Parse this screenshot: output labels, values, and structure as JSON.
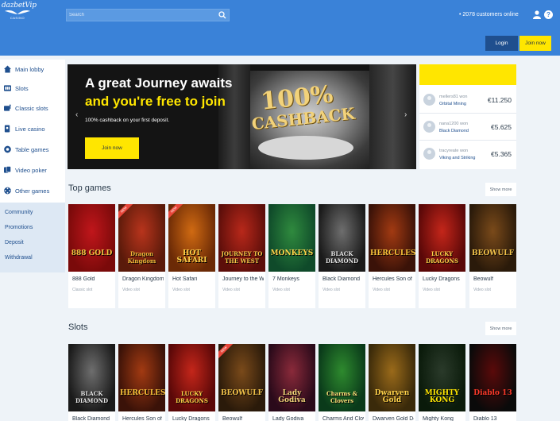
{
  "header": {
    "logo_text": "dazbetVip",
    "logo_sub": "CASINO",
    "search_placeholder": "Search",
    "online_text": "• 2078 customers online",
    "login_label": "Login",
    "join_label": "Join now"
  },
  "sidebar": {
    "items": [
      {
        "label": "Main lobby",
        "icon": "home-icon"
      },
      {
        "label": "Slots",
        "icon": "slots-icon"
      },
      {
        "label": "Classic slots",
        "icon": "classic-slots-icon"
      },
      {
        "label": "Live casino",
        "icon": "live-casino-icon"
      },
      {
        "label": "Table games",
        "icon": "table-games-icon"
      },
      {
        "label": "Video poker",
        "icon": "video-poker-icon"
      },
      {
        "label": "Other games",
        "icon": "other-games-icon"
      }
    ],
    "links": [
      "Community",
      "Promotions",
      "Deposit",
      "Withdrawal"
    ]
  },
  "banner": {
    "headline_1": "A great Journey awaits",
    "headline_2": "and you're free to join",
    "subtitle": "100% cashback on your first deposit.",
    "button": "Join now",
    "graphic_top": "100%",
    "graphic_bottom": "CASHBACK",
    "prev": "‹",
    "next": "›"
  },
  "winners": [
    {
      "name": "mellers81 won",
      "game": "Orbital Mining",
      "amount": "€11.250"
    },
    {
      "name": "nana1200 won",
      "game": "Black Diamond",
      "amount": "€5.625"
    },
    {
      "name": "tracyreate won",
      "game": "Viking and Striking",
      "amount": "€5.365"
    }
  ],
  "top_games": {
    "title": "Top games",
    "show_more": "Show more",
    "games": [
      {
        "name": "888 Gold",
        "type": "Classic slot",
        "art": "888 GOLD",
        "new": ""
      },
      {
        "name": "Dragon Kingdom",
        "type": "Video slot",
        "art": "Dragon Kingdom",
        "new": "NEW"
      },
      {
        "name": "Hot Safari",
        "type": "Video slot",
        "art": "HOT SAFARI",
        "new": "NEW"
      },
      {
        "name": "Journey to the West",
        "type": "Video slot",
        "art": "JOURNEY TO THE WEST",
        "new": ""
      },
      {
        "name": "7 Monkeys",
        "type": "Video slot",
        "art": "MONKEYS",
        "new": ""
      },
      {
        "name": "Black Diamond",
        "type": "Video slot",
        "art": "BLACK DIAMOND",
        "new": ""
      },
      {
        "name": "Hercules Son of Zeus",
        "type": "Video slot",
        "art": "HERCULES",
        "new": ""
      },
      {
        "name": "Lucky Dragons",
        "type": "Video slot",
        "art": "LUCKY DRAGONS",
        "new": ""
      },
      {
        "name": "Beowulf",
        "type": "Video slot",
        "art": "BEOWULF",
        "new": ""
      }
    ]
  },
  "slots": {
    "title": "Slots",
    "show_more": "Show more",
    "games": [
      {
        "name": "Black Diamond",
        "art": "BLACK DIAMOND",
        "new": ""
      },
      {
        "name": "Hercules Son of Zeus",
        "art": "HERCULES",
        "new": ""
      },
      {
        "name": "Lucky Dragons",
        "art": "LUCKY DRAGONS",
        "new": ""
      },
      {
        "name": "Beowulf",
        "art": "BEOWULF",
        "new": "NEW"
      },
      {
        "name": "Lady Godiva",
        "art": "Lady Godiva",
        "new": ""
      },
      {
        "name": "Charms And Clovers",
        "art": "Charms & Clovers",
        "new": ""
      },
      {
        "name": "Dwarven Gold Deluxe",
        "art": "Dwarven Gold",
        "new": ""
      },
      {
        "name": "Mighty Kong",
        "art": "MIGHTY KONG",
        "new": ""
      },
      {
        "name": "Diablo 13",
        "art": "Diablo 13",
        "new": ""
      }
    ]
  },
  "colors": {
    "brand_blue": "#3a82d8",
    "accent_yellow": "#ffe600",
    "dark_blue": "#1f4f8e"
  }
}
